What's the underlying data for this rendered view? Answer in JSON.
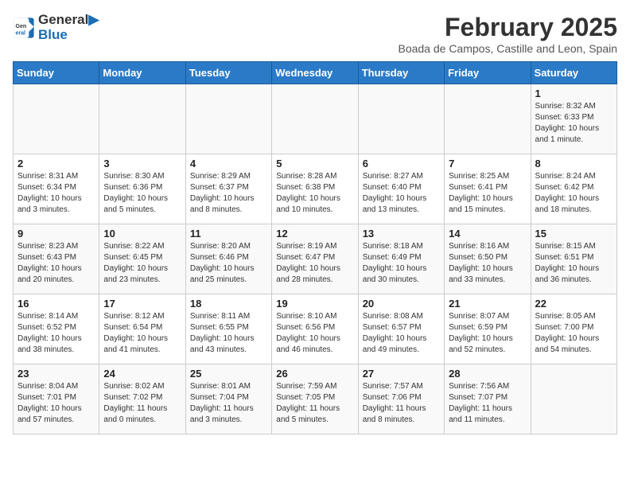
{
  "header": {
    "logo_line1": "General",
    "logo_line2": "Blue",
    "month_title": "February 2025",
    "location": "Boada de Campos, Castille and Leon, Spain"
  },
  "weekdays": [
    "Sunday",
    "Monday",
    "Tuesday",
    "Wednesday",
    "Thursday",
    "Friday",
    "Saturday"
  ],
  "weeks": [
    [
      {
        "day": "",
        "info": ""
      },
      {
        "day": "",
        "info": ""
      },
      {
        "day": "",
        "info": ""
      },
      {
        "day": "",
        "info": ""
      },
      {
        "day": "",
        "info": ""
      },
      {
        "day": "",
        "info": ""
      },
      {
        "day": "1",
        "info": "Sunrise: 8:32 AM\nSunset: 6:33 PM\nDaylight: 10 hours\nand 1 minute."
      }
    ],
    [
      {
        "day": "2",
        "info": "Sunrise: 8:31 AM\nSunset: 6:34 PM\nDaylight: 10 hours\nand 3 minutes."
      },
      {
        "day": "3",
        "info": "Sunrise: 8:30 AM\nSunset: 6:36 PM\nDaylight: 10 hours\nand 5 minutes."
      },
      {
        "day": "4",
        "info": "Sunrise: 8:29 AM\nSunset: 6:37 PM\nDaylight: 10 hours\nand 8 minutes."
      },
      {
        "day": "5",
        "info": "Sunrise: 8:28 AM\nSunset: 6:38 PM\nDaylight: 10 hours\nand 10 minutes."
      },
      {
        "day": "6",
        "info": "Sunrise: 8:27 AM\nSunset: 6:40 PM\nDaylight: 10 hours\nand 13 minutes."
      },
      {
        "day": "7",
        "info": "Sunrise: 8:25 AM\nSunset: 6:41 PM\nDaylight: 10 hours\nand 15 minutes."
      },
      {
        "day": "8",
        "info": "Sunrise: 8:24 AM\nSunset: 6:42 PM\nDaylight: 10 hours\nand 18 minutes."
      }
    ],
    [
      {
        "day": "9",
        "info": "Sunrise: 8:23 AM\nSunset: 6:43 PM\nDaylight: 10 hours\nand 20 minutes."
      },
      {
        "day": "10",
        "info": "Sunrise: 8:22 AM\nSunset: 6:45 PM\nDaylight: 10 hours\nand 23 minutes."
      },
      {
        "day": "11",
        "info": "Sunrise: 8:20 AM\nSunset: 6:46 PM\nDaylight: 10 hours\nand 25 minutes."
      },
      {
        "day": "12",
        "info": "Sunrise: 8:19 AM\nSunset: 6:47 PM\nDaylight: 10 hours\nand 28 minutes."
      },
      {
        "day": "13",
        "info": "Sunrise: 8:18 AM\nSunset: 6:49 PM\nDaylight: 10 hours\nand 30 minutes."
      },
      {
        "day": "14",
        "info": "Sunrise: 8:16 AM\nSunset: 6:50 PM\nDaylight: 10 hours\nand 33 minutes."
      },
      {
        "day": "15",
        "info": "Sunrise: 8:15 AM\nSunset: 6:51 PM\nDaylight: 10 hours\nand 36 minutes."
      }
    ],
    [
      {
        "day": "16",
        "info": "Sunrise: 8:14 AM\nSunset: 6:52 PM\nDaylight: 10 hours\nand 38 minutes."
      },
      {
        "day": "17",
        "info": "Sunrise: 8:12 AM\nSunset: 6:54 PM\nDaylight: 10 hours\nand 41 minutes."
      },
      {
        "day": "18",
        "info": "Sunrise: 8:11 AM\nSunset: 6:55 PM\nDaylight: 10 hours\nand 43 minutes."
      },
      {
        "day": "19",
        "info": "Sunrise: 8:10 AM\nSunset: 6:56 PM\nDaylight: 10 hours\nand 46 minutes."
      },
      {
        "day": "20",
        "info": "Sunrise: 8:08 AM\nSunset: 6:57 PM\nDaylight: 10 hours\nand 49 minutes."
      },
      {
        "day": "21",
        "info": "Sunrise: 8:07 AM\nSunset: 6:59 PM\nDaylight: 10 hours\nand 52 minutes."
      },
      {
        "day": "22",
        "info": "Sunrise: 8:05 AM\nSunset: 7:00 PM\nDaylight: 10 hours\nand 54 minutes."
      }
    ],
    [
      {
        "day": "23",
        "info": "Sunrise: 8:04 AM\nSunset: 7:01 PM\nDaylight: 10 hours\nand 57 minutes."
      },
      {
        "day": "24",
        "info": "Sunrise: 8:02 AM\nSunset: 7:02 PM\nDaylight: 11 hours\nand 0 minutes."
      },
      {
        "day": "25",
        "info": "Sunrise: 8:01 AM\nSunset: 7:04 PM\nDaylight: 11 hours\nand 3 minutes."
      },
      {
        "day": "26",
        "info": "Sunrise: 7:59 AM\nSunset: 7:05 PM\nDaylight: 11 hours\nand 5 minutes."
      },
      {
        "day": "27",
        "info": "Sunrise: 7:57 AM\nSunset: 7:06 PM\nDaylight: 11 hours\nand 8 minutes."
      },
      {
        "day": "28",
        "info": "Sunrise: 7:56 AM\nSunset: 7:07 PM\nDaylight: 11 hours\nand 11 minutes."
      },
      {
        "day": "",
        "info": ""
      }
    ]
  ]
}
